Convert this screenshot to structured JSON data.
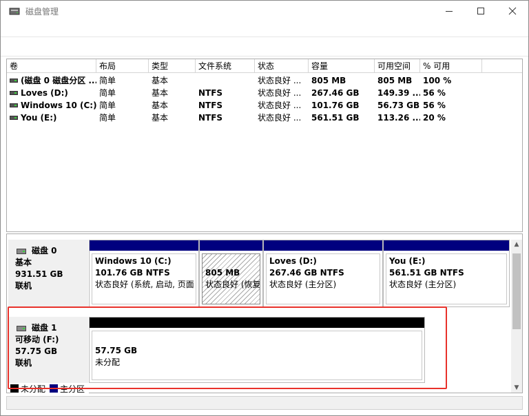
{
  "window": {
    "title": "磁盘管理"
  },
  "volume_table": {
    "columns": [
      "卷",
      "布局",
      "类型",
      "文件系统",
      "状态",
      "容量",
      "可用空间",
      "% 可用"
    ],
    "rows": [
      {
        "volume": "(磁盘 0 磁盘分区 ...",
        "layout": "简单",
        "type": "基本",
        "fs": "",
        "status": "状态良好 ...",
        "capacity": "805 MB",
        "free": "805 MB",
        "pct": "100 %"
      },
      {
        "volume": "Loves (D:)",
        "layout": "简单",
        "type": "基本",
        "fs": "NTFS",
        "status": "状态良好 ...",
        "capacity": "267.46 GB",
        "free": "149.39 ...",
        "pct": "56 %"
      },
      {
        "volume": "Windows 10 (C:)",
        "layout": "简单",
        "type": "基本",
        "fs": "NTFS",
        "status": "状态良好 ...",
        "capacity": "101.76 GB",
        "free": "56.73 GB",
        "pct": "56 %"
      },
      {
        "volume": "You (E:)",
        "layout": "简单",
        "type": "基本",
        "fs": "NTFS",
        "status": "状态良好 ...",
        "capacity": "561.51 GB",
        "free": "113.26 ...",
        "pct": "20 %"
      }
    ]
  },
  "disks": [
    {
      "name": "磁盘 0",
      "kind": "基本",
      "size": "931.51 GB",
      "state": "联机",
      "partitions": [
        {
          "title": "Windows 10  (C:)",
          "detail": "101.76 GB NTFS",
          "status": "状态良好 (系统, 启动, 页面"
        },
        {
          "title": "",
          "detail": "805 MB",
          "status": "状态良好 (恢复"
        },
        {
          "title": "Loves  (D:)",
          "detail": "267.46 GB NTFS",
          "status": "状态良好 (主分区)"
        },
        {
          "title": "You  (E:)",
          "detail": "561.51 GB NTFS",
          "status": "状态良好 (主分区)"
        }
      ]
    },
    {
      "name": "磁盘 1",
      "kind": "可移动 (F:)",
      "size": "57.75 GB",
      "state": "联机",
      "partitions": [
        {
          "detail": "57.75 GB",
          "status": "未分配"
        }
      ]
    }
  ],
  "legend": {
    "unallocated": "未分配",
    "primary": "主分区"
  },
  "colors": {
    "primary_partition": "#00007f",
    "unallocated": "#000000",
    "highlight": "#e8312a"
  },
  "icons": {
    "app": "disk-management-icon",
    "drive": "drive-icon",
    "disk": "disk-icon"
  }
}
